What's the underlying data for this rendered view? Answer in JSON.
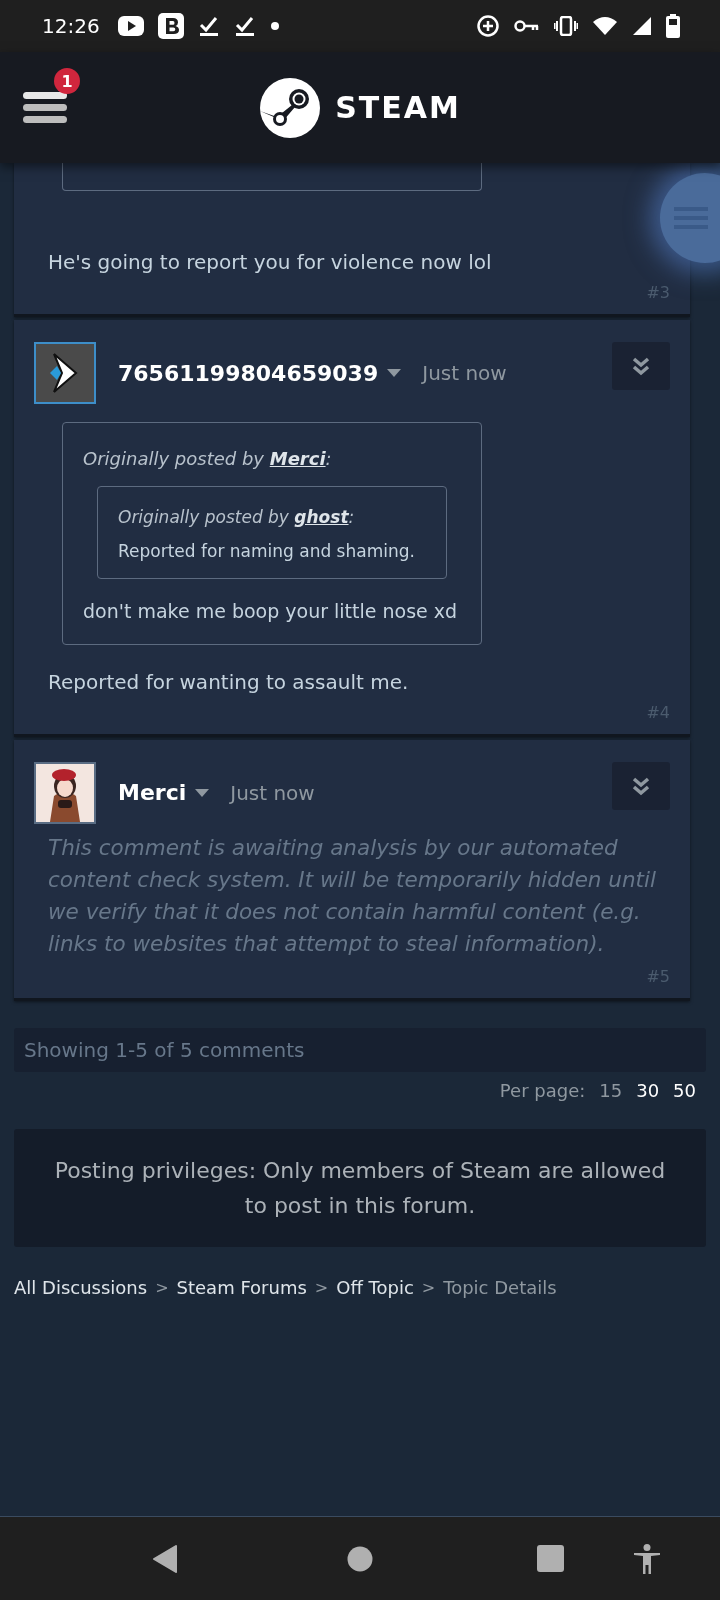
{
  "status_bar": {
    "time": "12:26"
  },
  "header": {
    "logo_text": "STEAM",
    "notification_count": "1"
  },
  "posts": [
    {
      "kind": "cut",
      "has_quote": true,
      "text": "He's going to report you for violence now lol",
      "number": "#3"
    },
    {
      "kind": "comment",
      "avatar": {
        "kind": "logo"
      },
      "author": "76561199804659039",
      "time": "Just now",
      "quote": {
        "heading": "Originally posted by **Merci**:",
        "quote": {
          "heading": "Originally posted by **ghost**:",
          "text": "Reported for naming and shaming."
        },
        "text": "don't make me boop your little nose xd"
      },
      "text": "Reported for wanting to assault me.",
      "number": "#4"
    },
    {
      "kind": "pending",
      "author": "Merci",
      "time": "Just now",
      "text": "This comment is awaiting analysis by our automated content check system. It will be temporarily hidden until we verify that it does not contain harmful content (e.g. links to websites that attempt to steal information).",
      "number": "#5"
    }
  ],
  "summary": "Showing 1-5 of 5 comments",
  "per_page": {
    "label": "Per page:",
    "options": [
      {
        "label": "15",
        "selected": true
      },
      {
        "label": "30",
        "selected": false
      },
      {
        "label": "50",
        "selected": false
      }
    ]
  },
  "notice": "Posting privileges: Only members of Steam are allowed to post in this forum.",
  "breadcrumb": [
    {
      "label": "All Discussions",
      "link": true
    },
    {
      "label": "Steam Forums",
      "link": true
    },
    {
      "label": "Off Topic",
      "link": true
    },
    {
      "label": "Topic Details",
      "link": false
    }
  ],
  "breadcrumb_separator": ">"
}
